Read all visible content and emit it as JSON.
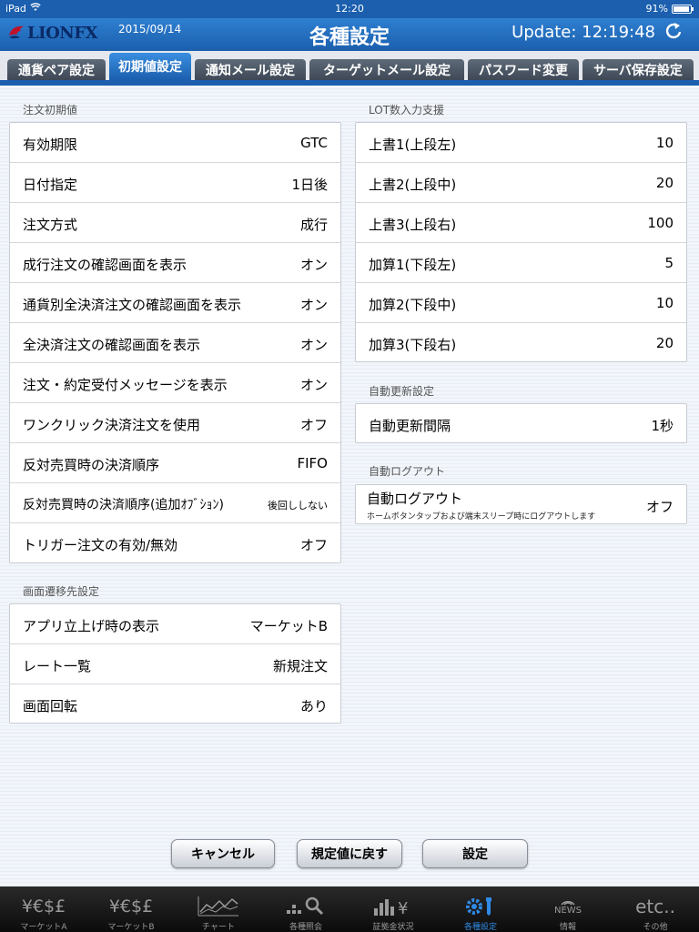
{
  "status_bar": {
    "device": "iPad",
    "time": "12:20",
    "battery": "91%"
  },
  "header": {
    "logo": "LIONFX",
    "date": "2015/09/14",
    "title": "各種設定",
    "update": "Update: 12:19:48"
  },
  "tabs": [
    {
      "label": "通貨ペア設定"
    },
    {
      "label": "初期値設定"
    },
    {
      "label": "通知メール設定"
    },
    {
      "label": "ターゲットメール設定"
    },
    {
      "label": "パスワード変更"
    },
    {
      "label": "サーバ保存設定"
    }
  ],
  "order_defaults": {
    "title": "注文初期値",
    "rows": [
      {
        "label": "有効期限",
        "value": "GTC"
      },
      {
        "label": "日付指定",
        "value": "1日後"
      },
      {
        "label": "注文方式",
        "value": "成行"
      },
      {
        "label": "成行注文の確認画面を表示",
        "value": "オン"
      },
      {
        "label": "通貨別全決済注文の確認画面を表示",
        "value": "オン"
      },
      {
        "label": "全決済注文の確認画面を表示",
        "value": "オン"
      },
      {
        "label": "注文・約定受付メッセージを表示",
        "value": "オン"
      },
      {
        "label": "ワンクリック決済注文を使用",
        "value": "オフ"
      },
      {
        "label": "反対売買時の決済順序",
        "value": "FIFO"
      },
      {
        "label": "反対売買時の決済順序(追加ｵﾌﾞｼｮﾝ)",
        "value": "後回ししない"
      },
      {
        "label": "トリガー注文の有効/無効",
        "value": "オフ"
      }
    ]
  },
  "screen_transition": {
    "title": "画面遷移先設定",
    "rows": [
      {
        "label": "アプリ立上げ時の表示",
        "value": "マーケットB"
      },
      {
        "label": "レート一覧",
        "value": "新規注文"
      },
      {
        "label": "画面回転",
        "value": "あり"
      }
    ]
  },
  "lot_input": {
    "title": "LOT数入力支援",
    "rows": [
      {
        "label": "上書1(上段左)",
        "value": "10"
      },
      {
        "label": "上書2(上段中)",
        "value": "20"
      },
      {
        "label": "上書3(上段右)",
        "value": "100"
      },
      {
        "label": "加算1(下段左)",
        "value": "5"
      },
      {
        "label": "加算2(下段中)",
        "value": "10"
      },
      {
        "label": "加算3(下段右)",
        "value": "20"
      }
    ]
  },
  "auto_update": {
    "title": "自動更新設定",
    "rows": [
      {
        "label": "自動更新間隔",
        "value": "1秒"
      }
    ]
  },
  "auto_logout": {
    "title": "自動ログアウト",
    "rows": [
      {
        "label": "自動ログアウト",
        "sub": "ホームボタンタップおよび端末スリープ時にログアウトします",
        "value": "オフ"
      }
    ]
  },
  "buttons": {
    "cancel": "キャンセル",
    "reset": "規定値に戻す",
    "set": "設定"
  },
  "bottom_nav": [
    {
      "icon": "¥€$£",
      "label": "マーケットA"
    },
    {
      "icon": "¥€$£",
      "label": "マーケットB"
    },
    {
      "icon": "chart-icon",
      "label": "チャート"
    },
    {
      "icon": "search-icon",
      "label": "各種照会"
    },
    {
      "icon": "margin-icon",
      "label": "証拠金状況"
    },
    {
      "icon": "settings-icon",
      "label": "各種設定"
    },
    {
      "icon": "NEWS",
      "label": "情報"
    },
    {
      "icon": "etc..",
      "label": "その他"
    }
  ],
  "colors": {
    "header_blue": "#1b5fae",
    "active_nav": "#2f8be6"
  }
}
